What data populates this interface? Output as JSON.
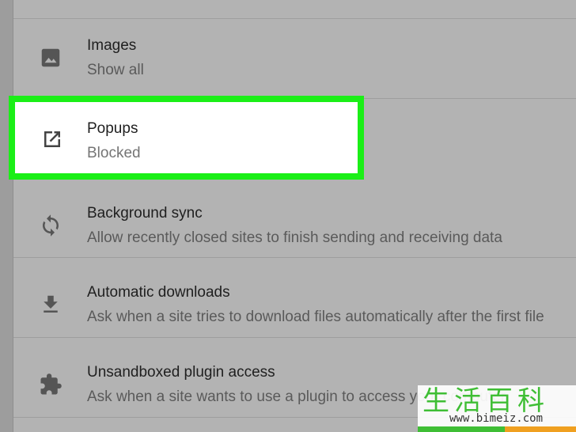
{
  "settings_rows": [
    {
      "title": "Images",
      "subtitle": "Show all",
      "icon": "image-icon"
    },
    {
      "title": "Popups",
      "subtitle": "Blocked",
      "icon": "open-in-new-icon",
      "highlighted": true
    },
    {
      "title": "Background sync",
      "subtitle": "Allow recently closed sites to finish sending and receiving data",
      "icon": "sync-icon"
    },
    {
      "title": "Automatic downloads",
      "subtitle": "Ask when a site tries to download files automatically after the first file",
      "icon": "download-icon"
    },
    {
      "title": "Unsandboxed plugin access",
      "subtitle": "Ask when a site wants to use a plugin to access your computer",
      "icon": "puzzle-icon"
    }
  ],
  "highlight_color": "#1bef17",
  "watermark": {
    "chars": "生活百科",
    "url": "www.bimeiz.com"
  }
}
